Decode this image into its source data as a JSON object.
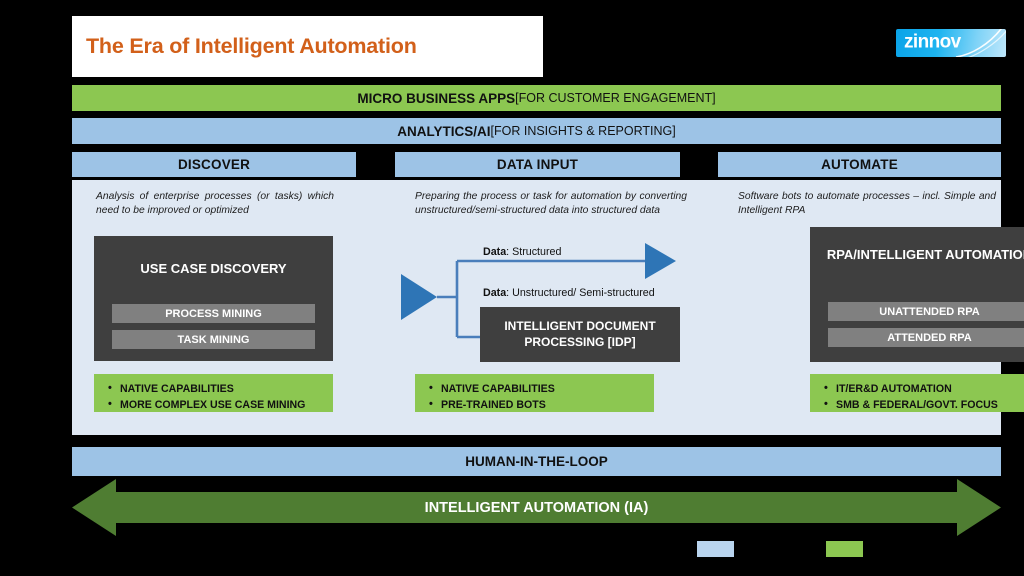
{
  "slide": {
    "title": "The Era of Intelligent Automation",
    "logo": {
      "text": "zinnov",
      "icon": "swoosh-icon"
    },
    "background_color": "#000000",
    "panel_color": "#dfe8f3"
  },
  "banners": {
    "micro_business_apps": {
      "strong": "MICRO BUSINESS APPS ",
      "light": "[FOR CUSTOMER ENGAGEMENT]",
      "color": "#8cc751"
    },
    "analytics_ai": {
      "strong": "ANALYTICS/AI ",
      "light": "[FOR INSIGHTS & REPORTING]",
      "color": "#9dc3e6"
    },
    "human_in_the_loop": {
      "label": "HUMAN-IN-THE-LOOP",
      "color": "#9dc3e6"
    },
    "intelligent_automation": {
      "label": "INTELLIGENT AUTOMATION (IA)",
      "color": "#4f7d32"
    }
  },
  "columns": [
    {
      "header": "DISCOVER",
      "description": "Analysis of enterprise processes (or tasks) which need to be improved or optimized",
      "box": {
        "title": "USE CASE DISCOVERY",
        "items": [
          "PROCESS MINING",
          "TASK MINING"
        ]
      },
      "capabilities": [
        "NATIVE CAPABILITIES",
        "MORE COMPLEX USE CASE MINING"
      ]
    },
    {
      "header": "DATA INPUT",
      "description": "Preparing the process or task for automation by converting unstructured/semi-structured data into structured data",
      "flow": {
        "structured_label_strong": "Data",
        "structured_label_rest": ": Structured",
        "unstructured_label_strong": "Data",
        "unstructured_label_rest": ": Unstructured/ Semi-structured",
        "idp_title": "INTELLIGENT DOCUMENT PROCESSING [IDP]",
        "arrow_color": "#2e75b6"
      },
      "capabilities": [
        "NATIVE CAPABILITIES",
        "PRE-TRAINED BOTS"
      ]
    },
    {
      "header": "AUTOMATE",
      "description": "Software bots to automate processes – incl. Simple and Intelligent RPA",
      "box": {
        "title": "RPA/INTELLIGENT AUTOMATION",
        "items": [
          "UNATTENDED RPA",
          "ATTENDED RPA"
        ]
      },
      "capabilities": [
        "IT/ER&D AUTOMATION",
        "SMB & FEDERAL/GOVT. FOCUS"
      ]
    }
  ],
  "legend": [
    {
      "name": "legend-swatch-blue",
      "color": "#b9d4ee"
    },
    {
      "name": "legend-swatch-green",
      "color": "#8cc751"
    }
  ]
}
